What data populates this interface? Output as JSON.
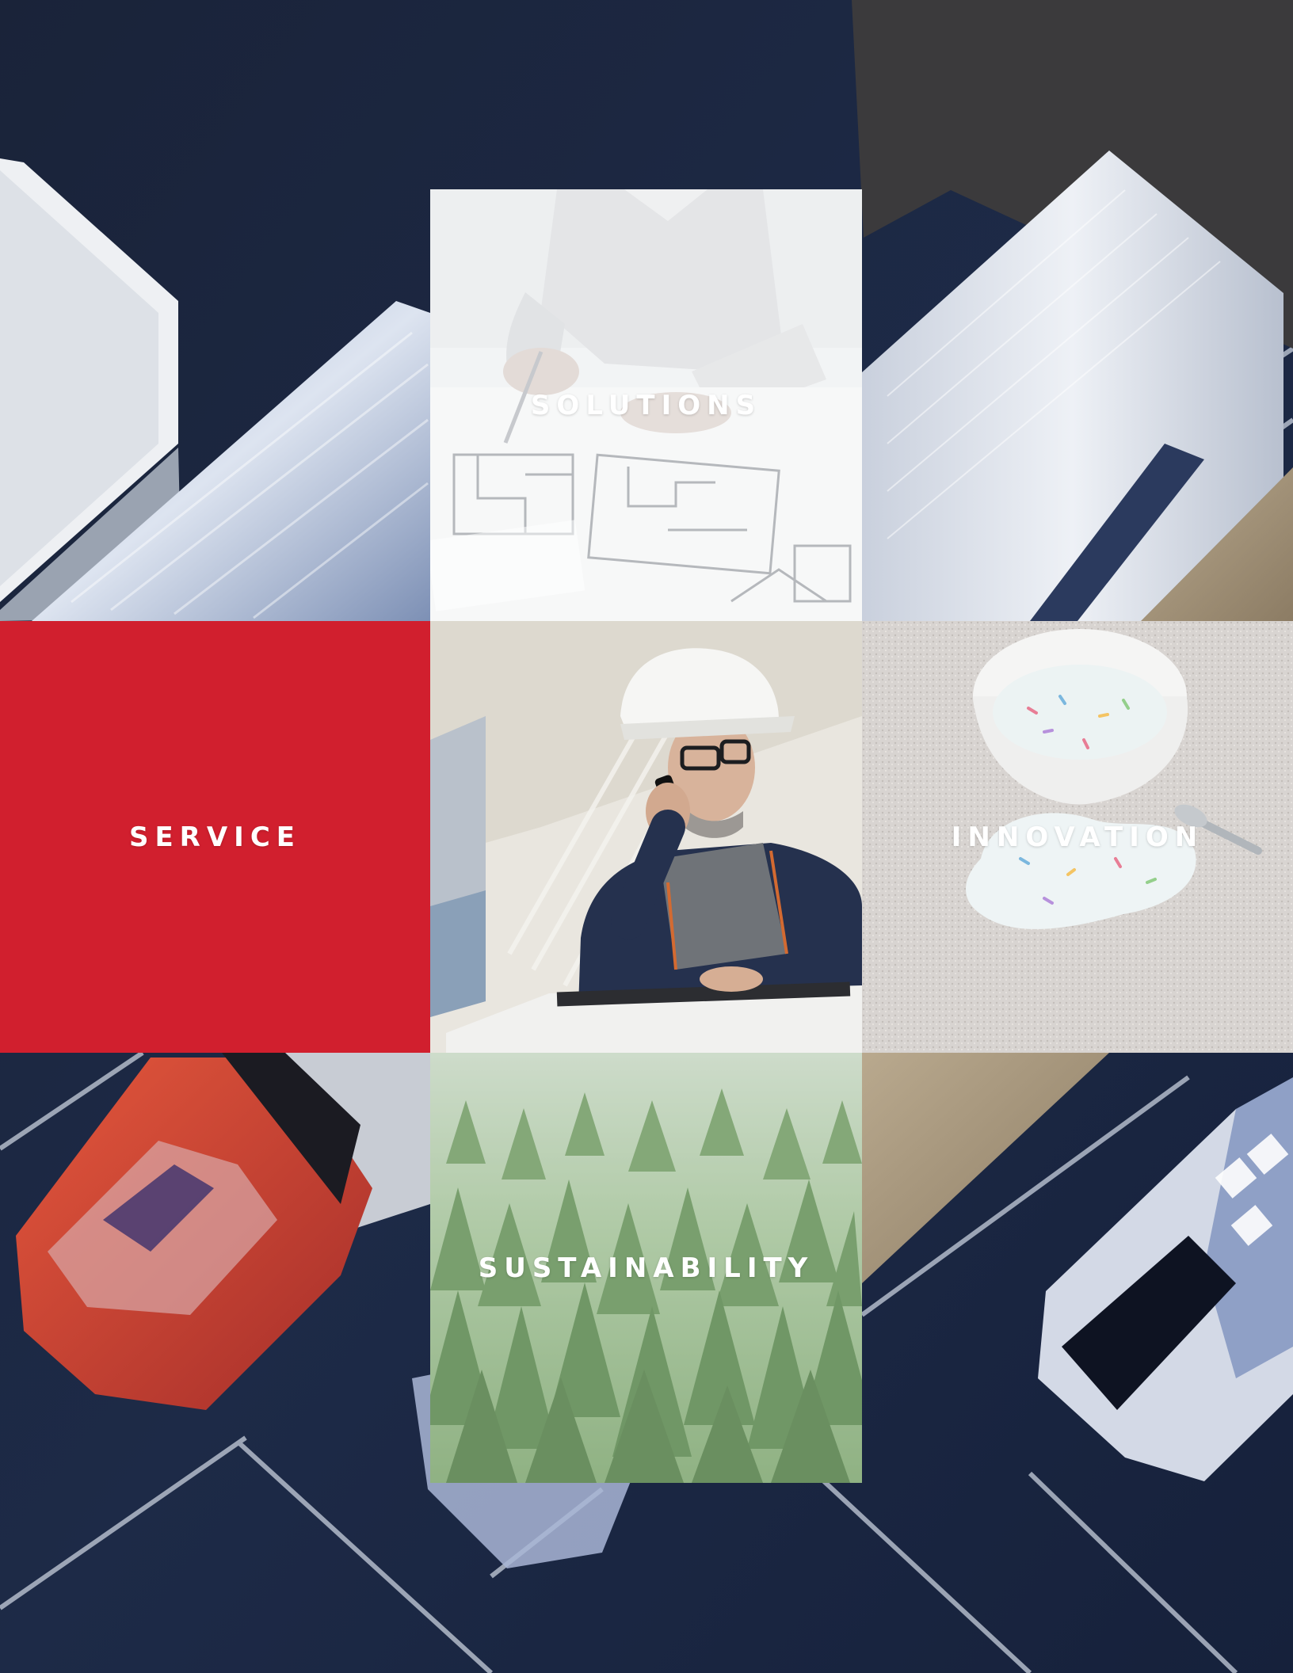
{
  "tiles": {
    "solutions": {
      "label": "SOLUTIONS"
    },
    "service": {
      "label": "SERVICE"
    },
    "innovation": {
      "label": "INNOVATION"
    },
    "sustainability": {
      "label": "SUSTAINABILITY"
    }
  },
  "colors": {
    "service_red": "#d11f2e",
    "background_navy": "#1b2640",
    "label_text": "#ffffff"
  },
  "images": {
    "background": "aerial-trucks-parking-photo",
    "solutions": "architect-drawing-floor-plan-photo",
    "center": "engineer-hard-hat-phone-photo",
    "innovation": "spilled-ice-cream-carpet-photo",
    "sustainability": "pine-forest-photo"
  }
}
